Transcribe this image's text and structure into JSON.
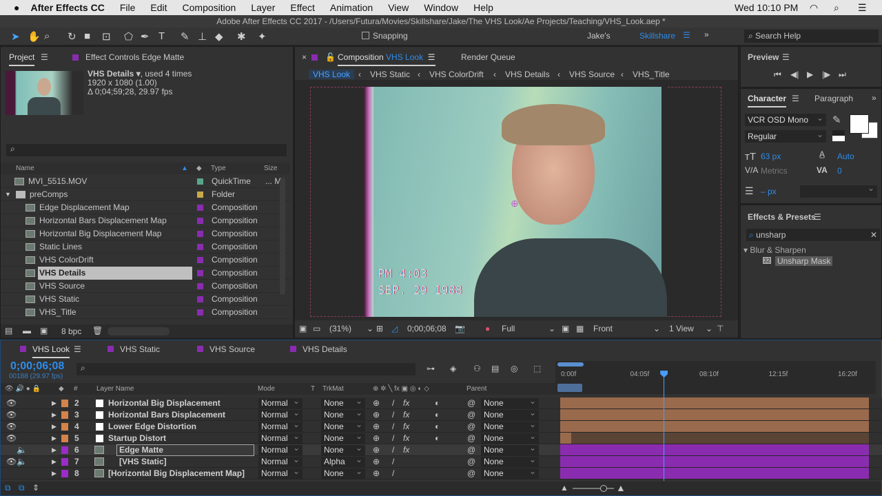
{
  "menubar": {
    "app": "After Effects CC",
    "items": [
      "File",
      "Edit",
      "Composition",
      "Layer",
      "Effect",
      "Animation",
      "View",
      "Window",
      "Help"
    ],
    "clock": "Wed 10:10 PM"
  },
  "window_title": "Adobe After Effects CC 2017 - /Users/Futura/Movies/Skillshare/Jake/The VHS Look/Ae Projects/Teaching/VHS_Look.aep *",
  "toolbar": {
    "snapping": "Snapping",
    "workspace_1": "Jake's",
    "workspace_active": "Skillshare",
    "search_help": "Search Help"
  },
  "project": {
    "tab": "Project",
    "effect_controls_tab": "Effect Controls Edge Matte",
    "selected_name": "VHS Details ▾",
    "used": ", used 4 times",
    "dims": "1920 x 1080 (1.00)",
    "duration": "Δ 0;04;59;28, 29.97 fps",
    "columns": {
      "name": "Name",
      "type": "Type",
      "size": "Size"
    },
    "items": [
      {
        "name": "MVI_5515.MOV",
        "type": "QuickTime",
        "size": "... M",
        "color": "#5aa58a",
        "indent": 0
      },
      {
        "name": "preComps",
        "type": "Folder",
        "color": "#c8a94a",
        "indent": 0,
        "folder": true
      },
      {
        "name": "Edge Displacement Map",
        "type": "Composition",
        "color": "#8a2cb0",
        "indent": 1
      },
      {
        "name": "Horizontal Bars Displacement Map",
        "type": "Composition",
        "color": "#8a2cb0",
        "indent": 1
      },
      {
        "name": "Horizontal Big Displacement Map",
        "type": "Composition",
        "color": "#8a2cb0",
        "indent": 1
      },
      {
        "name": "Static Lines",
        "type": "Composition",
        "color": "#8a2cb0",
        "indent": 1
      },
      {
        "name": "VHS ColorDrift",
        "type": "Composition",
        "color": "#8a2cb0",
        "indent": 1
      },
      {
        "name": "VHS Details",
        "type": "Composition",
        "color": "#8a2cb0",
        "indent": 1,
        "selected": true
      },
      {
        "name": "VHS Source",
        "type": "Composition",
        "color": "#8a2cb0",
        "indent": 1
      },
      {
        "name": "VHS Static",
        "type": "Composition",
        "color": "#8a2cb0",
        "indent": 1
      },
      {
        "name": "VHS_Title",
        "type": "Composition",
        "color": "#8a2cb0",
        "indent": 1
      }
    ],
    "bpc": "8 bpc"
  },
  "composition": {
    "tab_prefix": "Composition",
    "tab_name": "VHS Look",
    "render_queue": "Render Queue",
    "breadcrumbs": [
      "VHS Look",
      "VHS Static",
      "VHS ColorDrift",
      "VHS Details",
      "VHS Source",
      "VHS_Title"
    ],
    "overlay_time": "PM 4:03",
    "overlay_date": "SEP. 29 1988",
    "zoom": "(31%)",
    "timecode": "0;00;06;08",
    "resolution": "Full",
    "view": "Front",
    "views": "1 View"
  },
  "preview": {
    "title": "Preview"
  },
  "character": {
    "tab": "Character",
    "paragraph_tab": "Paragraph",
    "font": "VCR OSD Mono",
    "style": "Regular",
    "size": "63 px",
    "leading": "Auto",
    "kerning": "Metrics",
    "tracking": "0",
    "stroke": "– px"
  },
  "effects": {
    "title": "Effects & Presets",
    "search": "unsharp",
    "category": "▾ Blur & Sharpen",
    "item": "Unsharp Mask"
  },
  "timeline": {
    "tabs": [
      "VHS Look",
      "VHS Static",
      "VHS Source",
      "VHS Details"
    ],
    "timecode": "0;00;06;08",
    "frames": "00188 (29.97 fps)",
    "columns": {
      "num": "#",
      "layer_name": "Layer Name",
      "mode": "Mode",
      "t": "T",
      "trkmat": "TrkMat",
      "parent": "Parent"
    },
    "ruler": [
      "0:00f",
      "04:05f",
      "08:10f",
      "12:15f",
      "16:20f"
    ],
    "playhead_fraction": 0.33,
    "layers": [
      {
        "num": "2",
        "name": "Horizontal Big Displacement",
        "mode": "Normal",
        "trkmat": "None",
        "parent": "None",
        "color": "#d4834a",
        "solid": true,
        "eye": true
      },
      {
        "num": "3",
        "name": "Horizontal Bars Displacement",
        "mode": "Normal",
        "trkmat": "None",
        "parent": "None",
        "color": "#d4834a",
        "solid": true,
        "eye": true
      },
      {
        "num": "4",
        "name": "Lower Edge Distortion",
        "mode": "Normal",
        "trkmat": "None",
        "parent": "None",
        "color": "#d4834a",
        "solid": true,
        "eye": true
      },
      {
        "num": "5",
        "name": "Startup Distort",
        "mode": "Normal",
        "trkmat": "None",
        "parent": "None",
        "color": "#d4834a",
        "solid": true,
        "eye": true
      },
      {
        "num": "6",
        "name": "Edge Matte",
        "mode": "Normal",
        "trkmat": "None",
        "parent": "None",
        "color": "#9b2cc9",
        "selected": true
      },
      {
        "num": "7",
        "name": "[VHS Static]",
        "mode": "Normal",
        "trkmat": "Alpha",
        "parent": "None",
        "color": "#9b2cc9",
        "eye": true
      },
      {
        "num": "8",
        "name": "[Horizontal Big Displacement Map]",
        "mode": "Normal",
        "trkmat": "None",
        "parent": "None",
        "color": "#9b2cc9"
      }
    ]
  },
  "colors": {
    "accent": "#2d8ceb",
    "composition_label": "#8a2cb0",
    "solid_label": "#d4834a",
    "bar_brown": "#9a6a4c",
    "bar_purple": "#8a2cb0"
  }
}
